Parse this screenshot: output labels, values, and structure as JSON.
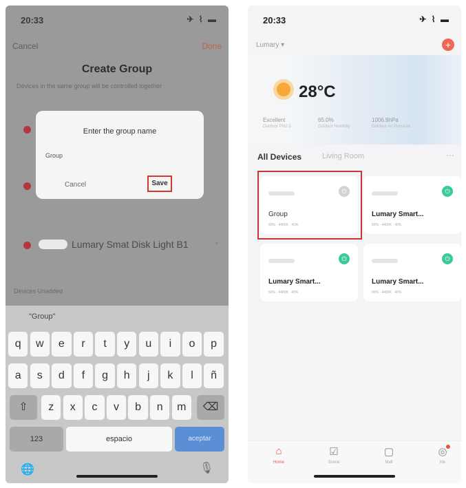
{
  "left": {
    "status_time": "20:33",
    "status_icons": "✈ ⌇ ▬",
    "cancel": "Cancel",
    "done": "Done",
    "title": "Create Group",
    "subtitle": "Devices in the same group will be controlled together",
    "dialog": {
      "title": "Enter the group name",
      "field_value": "Group",
      "cancel": "Cancel",
      "save": "Save"
    },
    "device": {
      "name": "Lumary Smat Disk Light B1",
      "plus": "+"
    },
    "unadded_header": "Devices Unadded",
    "keyboard": {
      "suggestion": "\"Group\"",
      "row1": [
        "q",
        "w",
        "e",
        "r",
        "t",
        "y",
        "u",
        "i",
        "o",
        "p"
      ],
      "row2": [
        "a",
        "s",
        "d",
        "f",
        "g",
        "h",
        "j",
        "k",
        "l",
        "ñ"
      ],
      "row3": [
        "z",
        "x",
        "c",
        "v",
        "b",
        "n",
        "m"
      ],
      "shift": "⇧",
      "delete": "⌫",
      "numbers": "123",
      "space": "espacio",
      "return": "aceptar",
      "globe": "🌐",
      "mic": "🎙"
    }
  },
  "right": {
    "status_time": "20:33",
    "status_icons": "✈ ⌇ ▬",
    "home_name": "Lumary ▾",
    "add": "+",
    "weather": {
      "temp": "28°C",
      "stats": [
        {
          "value": "Excellent",
          "label": "Outdoor PM2.5"
        },
        {
          "value": "65.0%",
          "label": "Outdoor Humidity"
        },
        {
          "value": "1006.9hPa",
          "label": "Outdoor Air Pressure"
        }
      ]
    },
    "tabs": [
      "All Devices",
      "Living Room"
    ],
    "more": "···",
    "cards": [
      {
        "name": "Group",
        "info": "60% · 4400K · 40%"
      },
      {
        "name": "Lumary Smart...",
        "info": "60% · 4400K · 40%"
      },
      {
        "name": "Lumary Smart...",
        "info": "60% · 4400K · 40%"
      },
      {
        "name": "Lumary Smart...",
        "info": "60% · 4400K · 40%"
      }
    ],
    "tabbar": [
      {
        "icon": "home-icon",
        "label": "Home"
      },
      {
        "icon": "scene-icon",
        "label": "Scene"
      },
      {
        "icon": "mall-icon",
        "label": "Mall"
      },
      {
        "icon": "me-icon",
        "label": "Me"
      }
    ]
  }
}
